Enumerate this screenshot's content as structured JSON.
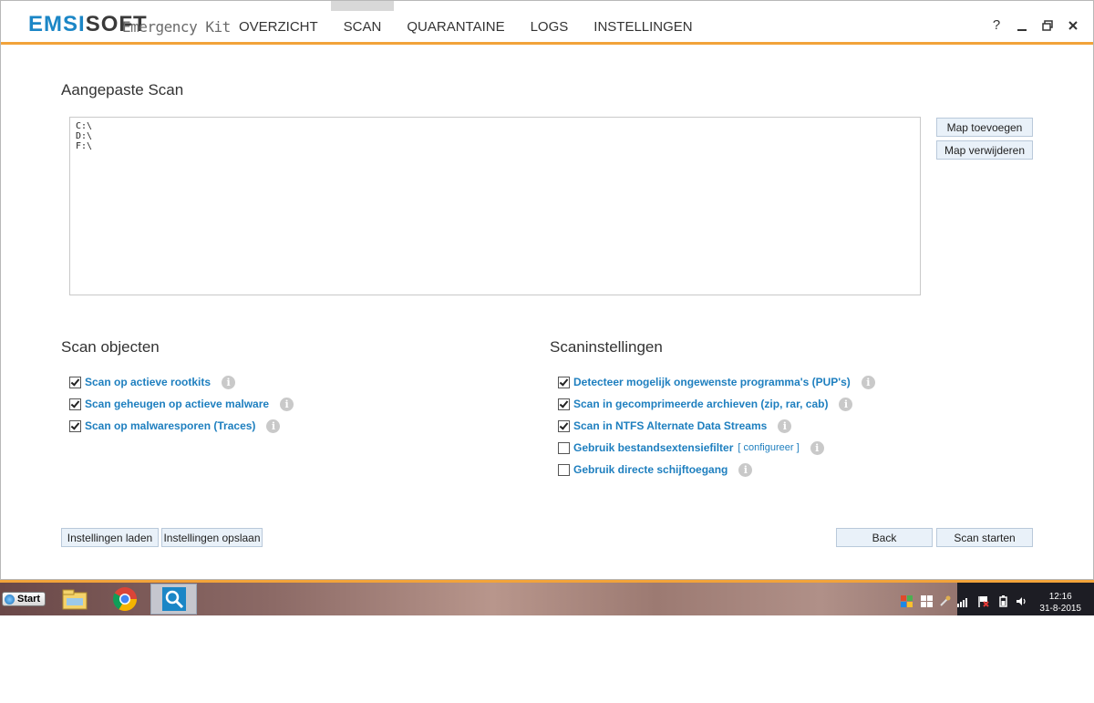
{
  "app": {
    "logo_main_a": "EMSI",
    "logo_main_b": "SOFT",
    "logo_sub": "Emergency Kit"
  },
  "nav": {
    "tabs": [
      {
        "label": "OVERZICHT",
        "active": false
      },
      {
        "label": "SCAN",
        "active": true
      },
      {
        "label": "QUARANTAINE",
        "active": false
      },
      {
        "label": "LOGS",
        "active": false
      },
      {
        "label": "INSTELLINGEN",
        "active": false
      }
    ]
  },
  "window_controls": {
    "help": "?"
  },
  "custom_scan": {
    "title": "Aangepaste Scan",
    "folders": [
      "C:\\",
      "D:\\",
      "F:\\"
    ],
    "add_folder": "Map toevoegen",
    "remove_folder": "Map verwijderen"
  },
  "scan_objects": {
    "title": "Scan objecten",
    "options": [
      {
        "label": "Scan op actieve rootkits",
        "checked": true
      },
      {
        "label": "Scan geheugen op actieve malware",
        "checked": true
      },
      {
        "label": "Scan op malwaresporen (Traces)",
        "checked": true
      }
    ]
  },
  "scan_settings": {
    "title": "Scaninstellingen",
    "options": [
      {
        "label": "Detecteer mogelijk ongewenste programma's (PUP's)",
        "checked": true
      },
      {
        "label": "Scan in gecomprimeerde archieven (zip, rar, cab)",
        "checked": true
      },
      {
        "label": "Scan in NTFS Alternate Data Streams",
        "checked": true
      },
      {
        "label": "Gebruik bestandsextensiefilter",
        "checked": false,
        "link": "[ configureer ]"
      },
      {
        "label": "Gebruik directe schijftoegang",
        "checked": false
      }
    ]
  },
  "footer": {
    "load_settings": "Instellingen laden",
    "save_settings": "Instellingen opslaan",
    "back": "Back",
    "start_scan": "Scan starten"
  },
  "taskbar": {
    "start_label": "Start",
    "clock_time": "12:16",
    "clock_date": "31-8-2015"
  },
  "colors": {
    "accent_orange": "#f2a33a",
    "link_blue": "#1e7fbf",
    "logo_blue": "#1b86c6"
  }
}
